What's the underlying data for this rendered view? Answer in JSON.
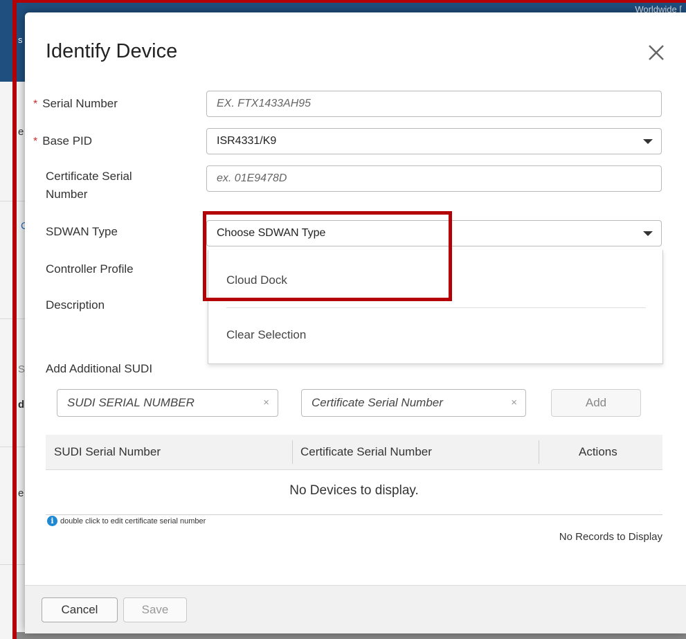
{
  "background": {
    "top_right_text": "Worldwide [",
    "left_fragments": [
      "s",
      "e",
      "C",
      "S",
      "d",
      "e"
    ]
  },
  "modal": {
    "title": "Identify Device",
    "close_icon": "close-icon",
    "fields": {
      "serial_number": {
        "label": "Serial Number",
        "required": "*",
        "placeholder": "EX. FTX1433AH95"
      },
      "base_pid": {
        "label": "Base PID",
        "required": "*",
        "value": "ISR4331/K9"
      },
      "certificate_serial": {
        "label": "Certificate Serial Number",
        "placeholder": "ex. 01E9478D"
      },
      "sdwan_type": {
        "label": "SDWAN Type",
        "value": "Choose SDWAN Type"
      },
      "controller_profile": {
        "label": "Controller Profile"
      },
      "description": {
        "label": "Description"
      }
    },
    "sdwan_dropdown": {
      "options": [
        "Cloud Dock",
        "Clear Selection"
      ]
    },
    "additional_sudi": {
      "label": "Add Additional SUDI",
      "sudi_placeholder": "SUDI SERIAL NUMBER",
      "cert_placeholder": "Certificate Serial Number",
      "clear_glyph": "×",
      "add_label": "Add"
    },
    "table": {
      "columns": [
        "SUDI Serial Number",
        "Certificate Serial Number",
        "Actions"
      ],
      "empty_message": "No Devices to display.",
      "info_note": "double click to edit certificate serial number",
      "records_text": "No Records to Display"
    },
    "footer": {
      "cancel_label": "Cancel",
      "save_label": "Save"
    }
  },
  "colors": {
    "highlight": "#b40007",
    "header_bg": "#1f4f7e",
    "required": "#c9302c",
    "info_icon": "#1e88d3"
  }
}
